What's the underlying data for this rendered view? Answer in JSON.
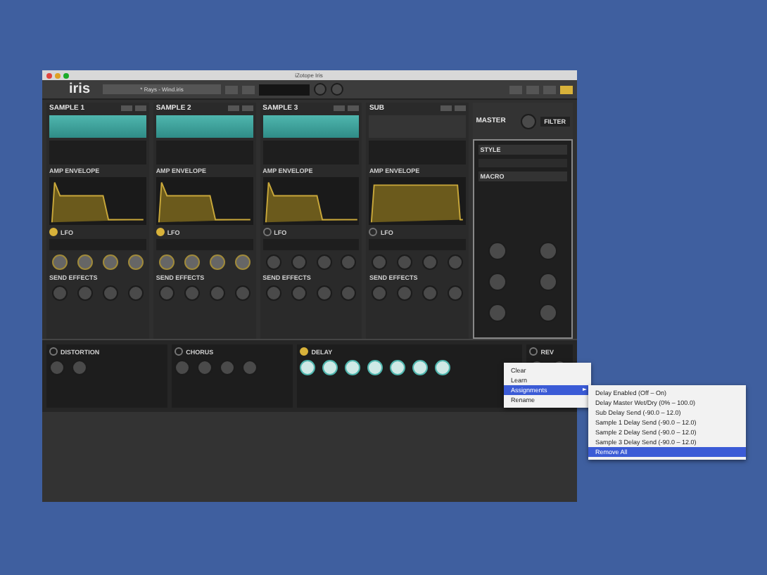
{
  "window": {
    "title": "iZotope Iris"
  },
  "toolbar": {
    "logo": "iris",
    "preset": "* Rays - Wind.iris"
  },
  "samples": [
    {
      "title": "SAMPLE 1",
      "kind": "sample",
      "envelope": {
        "label": "AMP ENVELOPE",
        "kind": "pluck"
      },
      "lfo_label": "LFO",
      "lfo_on": true,
      "send_label": "SEND EFFECTS"
    },
    {
      "title": "SAMPLE 2",
      "kind": "sample",
      "envelope": {
        "label": "AMP ENVELOPE",
        "kind": "pluck"
      },
      "lfo_label": "LFO",
      "lfo_on": true,
      "send_label": "SEND EFFECTS"
    },
    {
      "title": "SAMPLE 3",
      "kind": "sample",
      "envelope": {
        "label": "AMP ENVELOPE",
        "kind": "pluck"
      },
      "lfo_label": "LFO",
      "lfo_on": false,
      "send_label": "SEND EFFECTS"
    },
    {
      "title": "SUB",
      "kind": "sub",
      "envelope": {
        "label": "AMP ENVELOPE",
        "kind": "pad"
      },
      "lfo_label": "LFO",
      "lfo_on": false,
      "send_label": "SEND EFFECTS"
    }
  ],
  "master": {
    "title": "MASTER",
    "tab": "FILTER",
    "style_label": "STYLE",
    "macro_label": "MACRO"
  },
  "effects": [
    {
      "title": "DISTORTION",
      "on": false,
      "kind": "distortion"
    },
    {
      "title": "CHORUS",
      "on": false,
      "kind": "chorus"
    },
    {
      "title": "DELAY",
      "on": true,
      "kind": "delay"
    },
    {
      "title": "REV",
      "on": false,
      "kind": "reverb"
    }
  ],
  "context_menu": [
    {
      "label": "Clear",
      "selected": false,
      "submenu": false
    },
    {
      "label": "Learn",
      "selected": false,
      "submenu": false
    },
    {
      "label": "Assignments",
      "selected": true,
      "submenu": true
    },
    {
      "label": "Rename",
      "selected": false,
      "submenu": false
    }
  ],
  "submenu": [
    {
      "label": "Delay Enabled (Off – On)",
      "selected": false
    },
    {
      "label": "Delay Master Wet/Dry (0% – 100.0)",
      "selected": false
    },
    {
      "label": "Sub Delay Send (-90.0 – 12.0)",
      "selected": false
    },
    {
      "label": "Sample 1 Delay Send (-90.0 – 12.0)",
      "selected": false
    },
    {
      "label": "Sample 2 Delay Send (-90.0 – 12.0)",
      "selected": false
    },
    {
      "label": "Sample 3 Delay Send (-90.0 – 12.0)",
      "selected": false
    },
    {
      "label": "Remove All",
      "selected": true
    }
  ]
}
